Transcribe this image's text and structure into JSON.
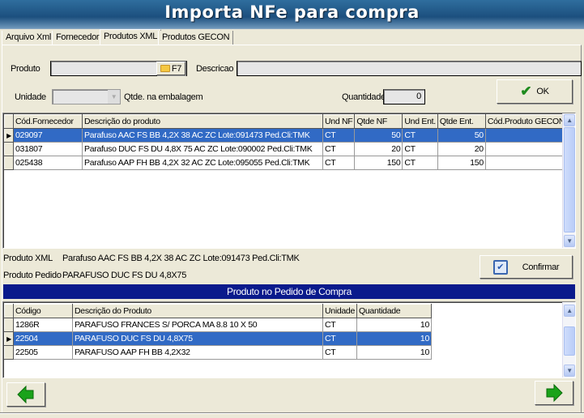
{
  "window": {
    "title": "Importa NFe para compra"
  },
  "tabs": [
    {
      "label": "Arquivo Xml"
    },
    {
      "label": "Fornecedor"
    },
    {
      "label": "Produtos XML",
      "active": true
    },
    {
      "label": "Produtos GECON"
    }
  ],
  "form": {
    "produto_label": "Produto",
    "produto_value": "",
    "f7_label": "F7",
    "descricao_label": "Descricao",
    "descricao_value": "",
    "unidade_label": "Unidade",
    "unidade_value": "",
    "qtde_embalagem_label": "Qtde. na embalagem",
    "quantidade_label": "Quantidade",
    "quantidade_value": "0",
    "ok_label": "OK"
  },
  "xml_grid": {
    "columns": [
      "Cód.Fornecedor",
      "Descrição do produto",
      "Und NF",
      "Qtde NF",
      "Und Ent.",
      "Qtde Ent.",
      "Cód.Produto GECON"
    ],
    "rows": [
      [
        "029097",
        "Parafuso AAC FS BB  4,2X 38   AC ZC Lote:091473 Ped.Cli:TMK",
        "CT",
        "50",
        "CT",
        "50",
        ""
      ],
      [
        "031807",
        "Parafuso DUC FS DU  4,8X 75   AC ZC Lote:090002 Ped.Cli:TMK",
        "CT",
        "20",
        "CT",
        "20",
        ""
      ],
      [
        "025438",
        "Parafuso AAP FH BB  4,2X 32   AC ZC Lote:095055 Ped.Cli:TMK",
        "CT",
        "150",
        "CT",
        "150",
        ""
      ]
    ],
    "selected_row": 0
  },
  "info": {
    "produto_xml_label": "Produto XML",
    "produto_xml_value": "Parafuso AAC FS BB  4,2X 38   AC ZC Lote:091473 Ped.Cli:TMK",
    "produto_pedido_label": "Produto Pedido",
    "produto_pedido_value": "PARAFUSO DUC FS DU 4,8X75",
    "confirmar_label": "Confirmar"
  },
  "pedido": {
    "banner": "Produto no Pedido de Compra",
    "columns": [
      "Código",
      "Descrição do Produto",
      "Unidade",
      "Quantidade"
    ],
    "rows": [
      [
        "1286R",
        "PARAFUSO FRANCES S/ PORCA MA 8.8 10 X 50",
        "CT",
        "10"
      ],
      [
        "22504",
        "PARAFUSO DUC FS DU 4,8X75",
        "CT",
        "10"
      ],
      [
        "22505",
        "PARAFUSO AAP FH BB 4,2X32",
        "CT",
        "10"
      ]
    ],
    "selected_row": 1
  },
  "nav": {
    "prev_icon": "green-arrow-left-icon",
    "next_icon": "green-arrow-right-icon"
  },
  "colors": {
    "selection": "#316ac5",
    "banner": "#0a1a8c"
  }
}
